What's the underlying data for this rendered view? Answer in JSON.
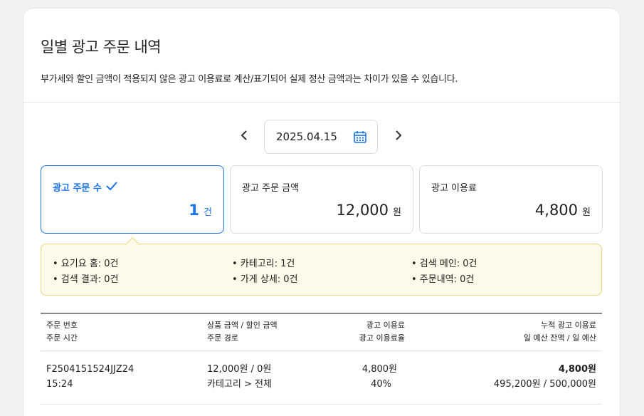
{
  "page": {
    "title": "일별 광고 주문 내역",
    "notice": "부가세와 할인 금액이 적용되지 않은 광고 이용료로 계산/표기되어 실제 정산 금액과는 차이가 있을 수 있습니다."
  },
  "date_picker": {
    "date": "2025.04.15",
    "prev_icon": "chevron-left-icon",
    "next_icon": "chevron-right-icon",
    "calendar_icon": "calendar-icon"
  },
  "colors": {
    "accent": "#1a73e8",
    "notice_bg": "#fffbea",
    "notice_border": "#f0d67a"
  },
  "stats": [
    {
      "label": "광고 주문 수",
      "value": "1",
      "unit": "건",
      "selected": true
    },
    {
      "label": "광고 주문 금액",
      "value": "12,000",
      "unit": "원",
      "selected": false
    },
    {
      "label": "광고 이용료",
      "value": "4,800",
      "unit": "원",
      "selected": false
    }
  ],
  "breakdown": [
    "• 요기요 홈: 0건",
    "• 카테고리: 1건",
    "• 검색 메인: 0건",
    "• 검색 결과: 0건",
    "• 가게 상세: 0건",
    "• 주문내역: 0건"
  ],
  "table": {
    "headers": {
      "col1": [
        "주문 번호",
        "주문 시간"
      ],
      "col2": [
        "상품 금액 / 할인 금액",
        "주문 경로"
      ],
      "col3": [
        "광고 이용료",
        "광고 이용료율"
      ],
      "col4": [
        "누적 광고 이용료",
        "일 예산 잔액 / 일 예산"
      ]
    },
    "rows": [
      {
        "order_no": "F2504151524JJZ24",
        "order_time": "15:24",
        "amount": "12,000원 / 0원",
        "route": "카테고리 > 전체",
        "fee": "4,800원",
        "fee_rate": "40%",
        "cumulative": "4,800원",
        "budget": "495,200원 / 500,000원"
      }
    ]
  }
}
